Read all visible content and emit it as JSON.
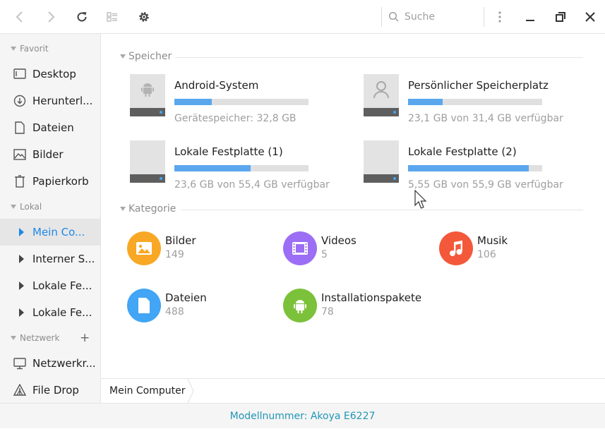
{
  "toolbar": {
    "back_icon": "chevron-left-icon",
    "forward_icon": "chevron-right-icon",
    "reload_icon": "reload-icon",
    "view_icon": "list-view-icon",
    "settings_icon": "gear-icon",
    "search_placeholder": "Suche",
    "menu_icon": "more-vertical-icon",
    "minimize_icon": "minimize-icon",
    "maximize_icon": "restore-icon",
    "close_icon": "close-icon"
  },
  "sidebar": {
    "favorites_title": "Favorit",
    "favorites": [
      {
        "label": "Desktop",
        "icon": "desktop-icon"
      },
      {
        "label": "Herunterl...",
        "icon": "download-icon"
      },
      {
        "label": "Dateien",
        "icon": "file-icon"
      },
      {
        "label": "Bilder",
        "icon": "image-icon"
      },
      {
        "label": "Papierkorb",
        "icon": "trash-icon"
      }
    ],
    "local_title": "Lokal",
    "local": [
      {
        "label": "Mein Co...",
        "active": true
      },
      {
        "label": "Interner S..."
      },
      {
        "label": "Lokale Fe..."
      },
      {
        "label": "Lokale Fe..."
      }
    ],
    "network_title": "Netzwerk",
    "network_add": "+",
    "network": [
      {
        "label": "Netzwerkr...",
        "icon": "network-icon"
      },
      {
        "label": "File Drop",
        "icon": "file-drop-icon"
      }
    ]
  },
  "storage": {
    "title": "Speicher",
    "drives": [
      {
        "name": "Android-System",
        "info": "Gerätespeicher: 32,8 GB",
        "fill": 0.28,
        "icon": "android-icon"
      },
      {
        "name": "Persönlicher Speicherplatz",
        "info": "23,1 GB von 31,4 GB verfügbar",
        "fill": 0.26,
        "icon": "person-icon"
      },
      {
        "name": "Lokale Festplatte (1)",
        "info": "23,6 GB von 55,4 GB verfügbar",
        "fill": 0.57,
        "icon": "drive-icon"
      },
      {
        "name": "Lokale Festplatte (2)",
        "info": "5,55 GB von 55,9 GB verfügbar",
        "fill": 0.9,
        "icon": "drive-icon"
      }
    ]
  },
  "categories": {
    "title": "Kategorie",
    "items": [
      {
        "name": "Bilder",
        "count": "149",
        "color": "#f9a825",
        "icon": "image-icon"
      },
      {
        "name": "Videos",
        "count": "5",
        "color": "#9c6ef5",
        "icon": "video-icon"
      },
      {
        "name": "Musik",
        "count": "106",
        "color": "#f4583a",
        "icon": "music-icon"
      },
      {
        "name": "Dateien",
        "count": "488",
        "color": "#42a5f5",
        "icon": "document-icon"
      },
      {
        "name": "Installationspakete",
        "count": "78",
        "color": "#7cc13a",
        "icon": "android-icon"
      }
    ]
  },
  "pathbar": {
    "crumb": "Mein Computer"
  },
  "footer": {
    "text": "Modellnummer: Akoya E6227"
  }
}
